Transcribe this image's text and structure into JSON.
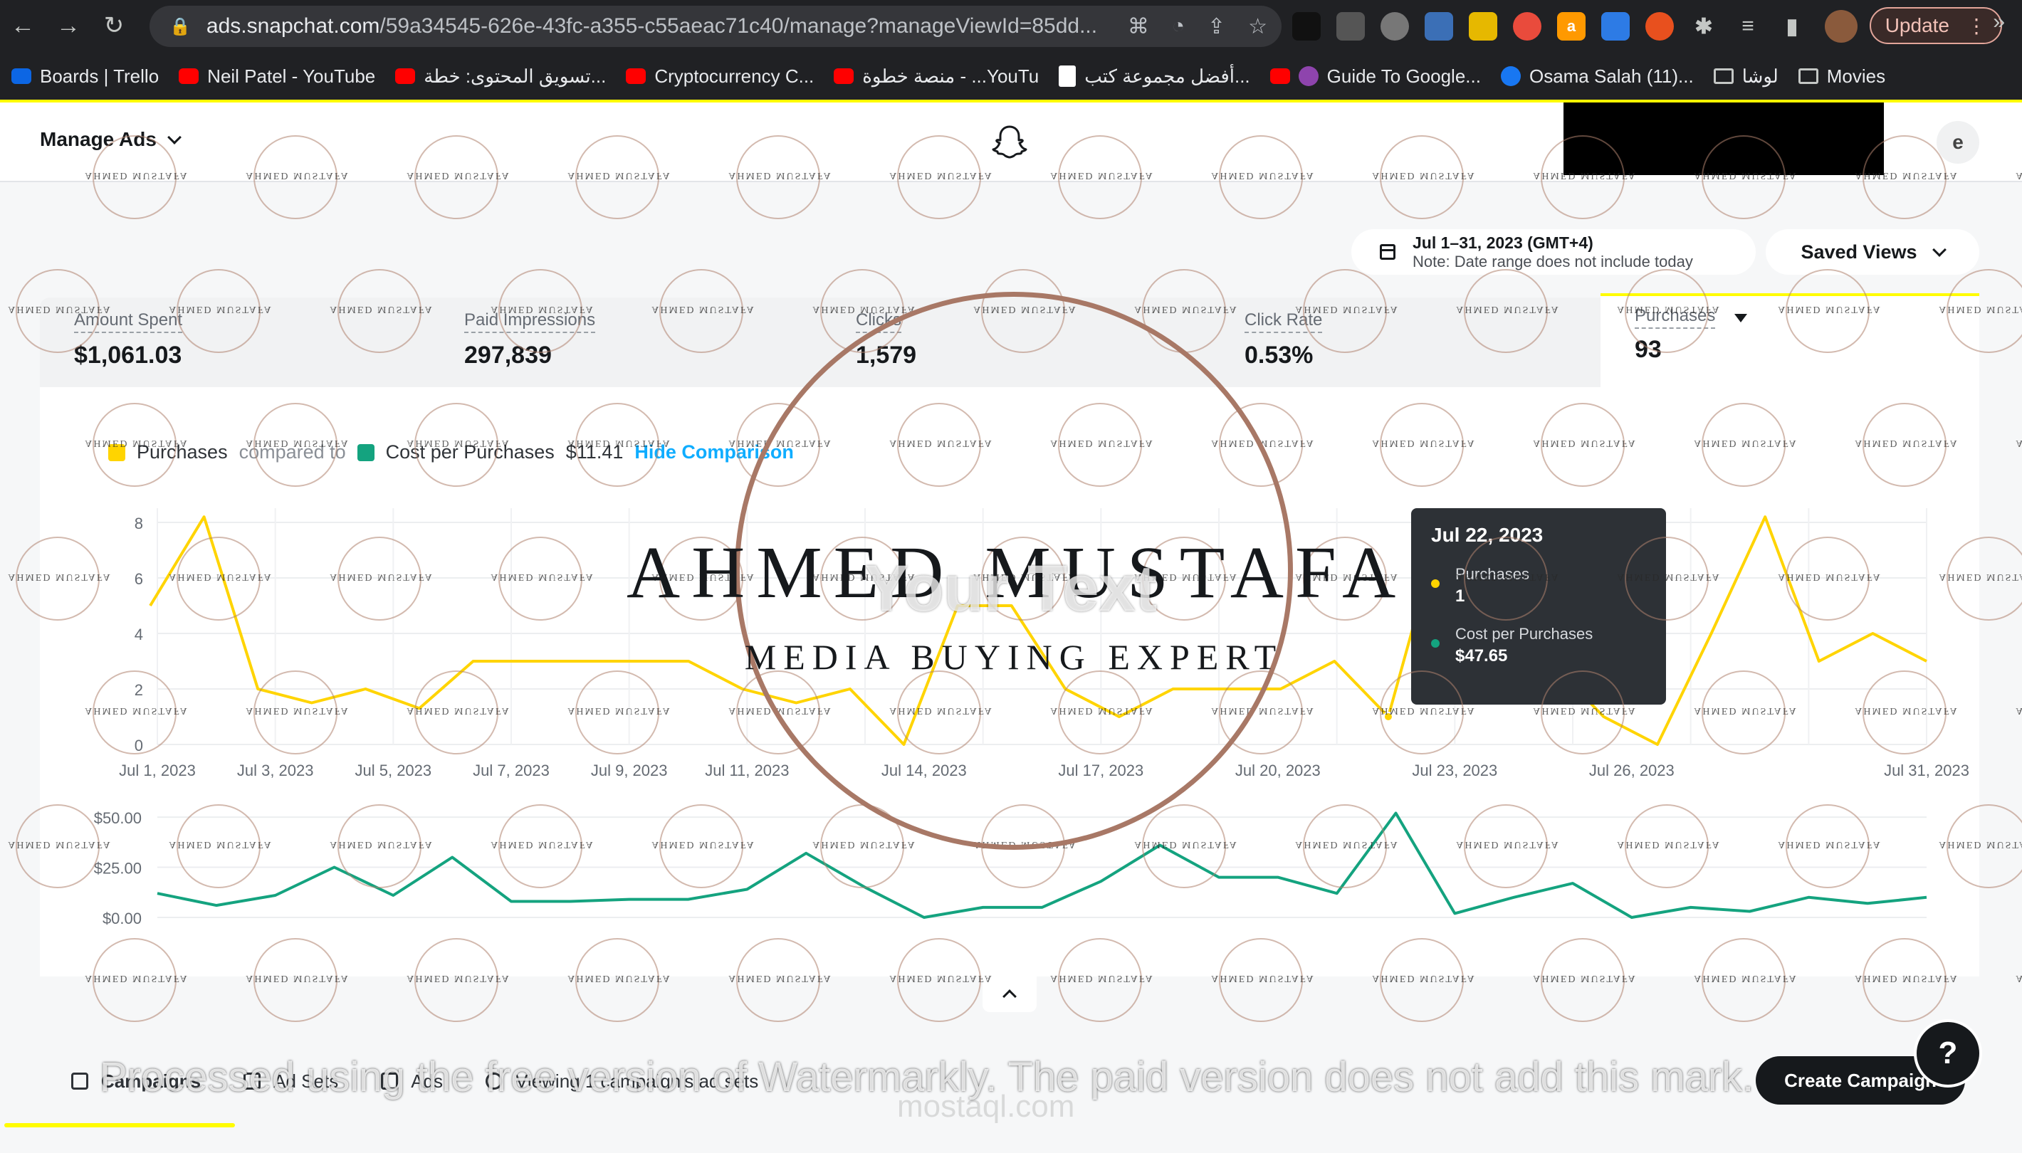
{
  "browser": {
    "url_host": "ads.snapchat.com",
    "url_path": "/59a34545-626e-43fc-a355-c55aeac71c40/manage?manageViewId=85dd...",
    "update_label": "Update",
    "bookmarks": [
      {
        "label": "Boards | Trello",
        "icon": "trello-icon"
      },
      {
        "label": "Neil Patel - YouTube",
        "icon": "youtube-icon"
      },
      {
        "label": "تسويق المحتوى: خطة...",
        "icon": "youtube-icon"
      },
      {
        "label": "Cryptocurrency C...",
        "icon": "youtube-icon"
      },
      {
        "label": "منصة خطوة - ...YouTu",
        "icon": "youtube-icon"
      },
      {
        "label": "أفضل مجموعة كتب...",
        "icon": "document-icon"
      },
      {
        "label": "Guide To Google...",
        "icon": "youtube-icon"
      },
      {
        "label": "Osama Salah (11)...",
        "icon": "facebook-icon"
      },
      {
        "label": "لوشا",
        "icon": "folder-icon"
      },
      {
        "label": "Movies",
        "icon": "folder-icon"
      }
    ]
  },
  "header": {
    "title": "Manage Ads",
    "user_initial": "e"
  },
  "date_range": {
    "label": "Jul 1–31, 2023 (GMT+4)",
    "note": "Note: Date range does not include today"
  },
  "saved_views_label": "Saved Views",
  "metrics": [
    {
      "label": "Amount Spent",
      "value": "$1,061.03"
    },
    {
      "label": "Paid Impressions",
      "value": "297,839"
    },
    {
      "label": "Clicks",
      "value": "1,579"
    },
    {
      "label": "Click Rate",
      "value": "0.53%"
    },
    {
      "label": "Purchases",
      "value": "93"
    }
  ],
  "legend": {
    "primary": "Purchases",
    "compared_to": "compared to",
    "secondary": "Cost per Purchases",
    "secondary_value": "$11.41",
    "hide_link": "Hide Comparison"
  },
  "colors": {
    "purchases": "#ffd400",
    "cost": "#14a37f",
    "accent": "#fffc00",
    "link": "#0fadff"
  },
  "chart_data": [
    {
      "type": "line",
      "series": [
        {
          "name": "Purchases",
          "values": [
            5,
            8.2,
            2,
            1.5,
            2,
            1.3,
            3,
            3,
            3,
            3,
            3,
            2,
            1.5,
            2,
            0,
            5,
            5,
            2,
            1,
            2,
            2,
            2,
            3,
            1,
            8,
            4,
            3,
            1,
            0,
            4,
            8.2,
            3,
            4,
            3
          ]
        }
      ],
      "x_labels": [
        "Jul 1, 2023",
        "Jul 3, 2023",
        "Jul 5, 2023",
        "Jul 7, 2023",
        "Jul 9, 2023",
        "Jul 11, 2023",
        "Jul 14, 2023",
        "Jul 17, 2023",
        "Jul 20, 2023",
        "Jul 23, 2023",
        "Jul 26, 2023",
        "Jul 31, 2023"
      ],
      "y_ticks": [
        "0",
        "2",
        "4",
        "6",
        "8"
      ],
      "ylim": [
        0,
        8
      ]
    },
    {
      "type": "line",
      "series": [
        {
          "name": "Cost per Purchases",
          "values": [
            12,
            6,
            11,
            25,
            11,
            30,
            8,
            8,
            9,
            9,
            14,
            32,
            15,
            0,
            5,
            5,
            18,
            36,
            20,
            20,
            12,
            52,
            2,
            10,
            17,
            0,
            5,
            3,
            10,
            7,
            10
          ]
        }
      ],
      "y_ticks": [
        "$0.00",
        "$25.00",
        "$50.00"
      ],
      "ylim": [
        0,
        55
      ]
    }
  ],
  "tooltip": {
    "date": "Jul 22, 2023",
    "rows": [
      {
        "label": "Purchases",
        "value": "1"
      },
      {
        "label": "Cost per Purchases",
        "value": "$47.65"
      }
    ]
  },
  "tabs": [
    {
      "label": "Campaigns",
      "icon": "megaphone-icon"
    },
    {
      "label": "Ad Sets",
      "icon": "layers-icon"
    },
    {
      "label": "Ads",
      "icon": "ad-icon"
    },
    {
      "label": "Viewing 1 campaign's ad sets",
      "icon": "info-icon"
    }
  ],
  "create_label": "Create Campaign",
  "help_label": "?",
  "watermark": {
    "name": "AHMED MUSTAFA",
    "tagline": "MEDIA BUYING EXPERT",
    "overlay_text": "Your Text",
    "footer": "Processed using the free version of Watermarkly. The paid version does not add this mark.",
    "site": "mostaql.com",
    "tile_text": "AHMED MUSTAFA"
  }
}
